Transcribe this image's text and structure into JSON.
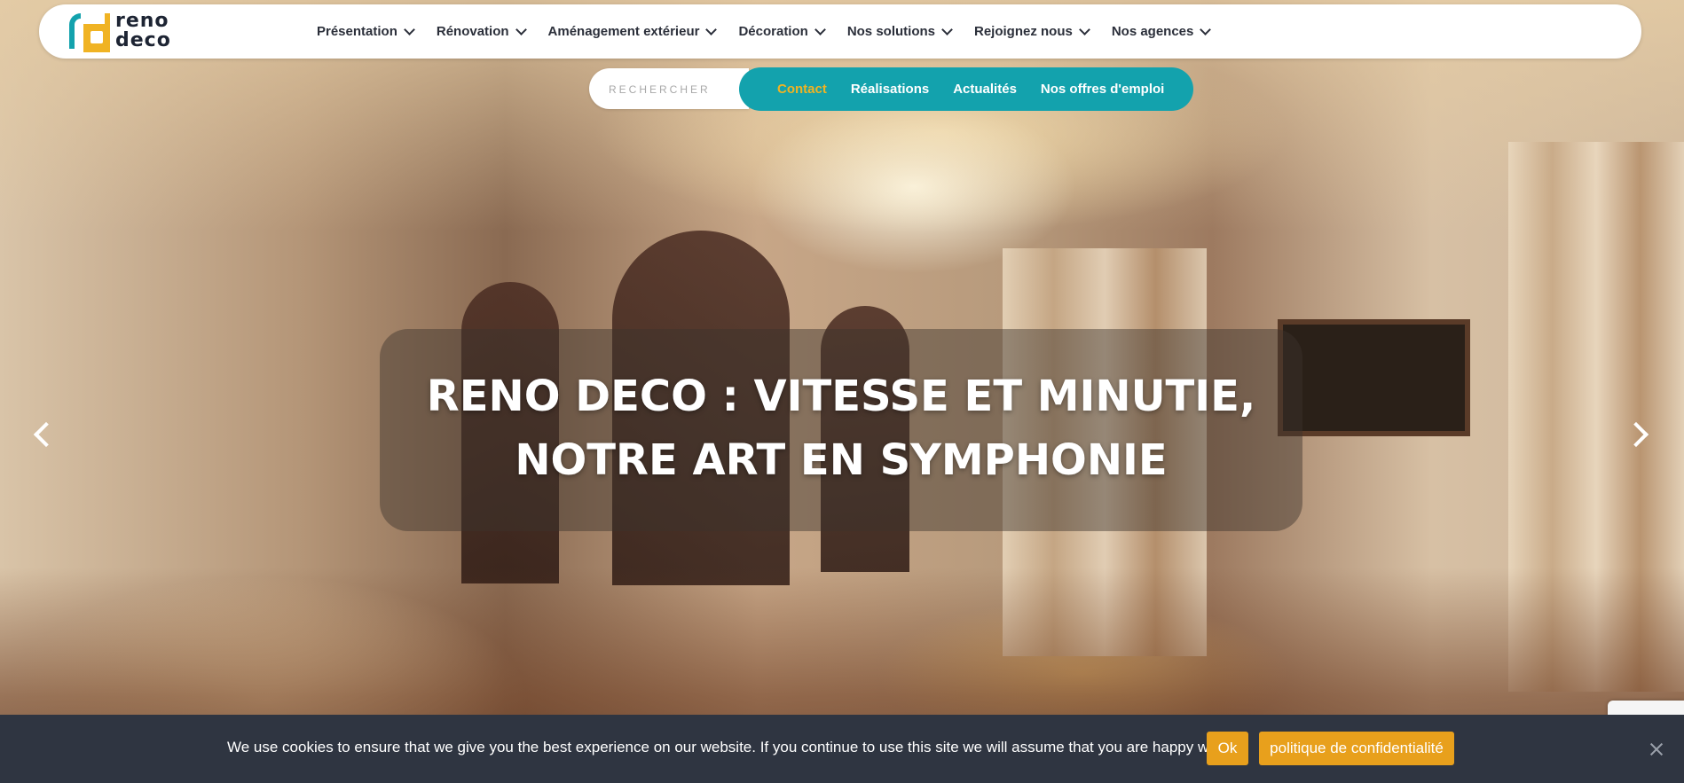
{
  "logo": {
    "line1": "reno",
    "line2": "deco"
  },
  "nav": {
    "items": [
      {
        "label": "Présentation"
      },
      {
        "label": "Rénovation"
      },
      {
        "label": "Aménagement extérieur"
      },
      {
        "label": "Décoration"
      },
      {
        "label": "Nos solutions"
      },
      {
        "label": "Rejoignez nous"
      },
      {
        "label": "Nos agences"
      }
    ]
  },
  "search": {
    "placeholder": "RECHERCHER"
  },
  "subnav": {
    "items": [
      {
        "label": "Contact"
      },
      {
        "label": "Réalisations"
      },
      {
        "label": "Actualités"
      },
      {
        "label": "Nos offres d'emploi"
      }
    ],
    "active_color": "#f0b323"
  },
  "hero": {
    "headline_line1": "RENO DECO : VITESSE ET MINUTIE,",
    "headline_line2": "NOTRE ART EN SYMPHONIE"
  },
  "cookie": {
    "text": "We use cookies to ensure that we give you the best experience on our website. If you continue to use this site we will assume that you are happy with it.",
    "ok_label": "Ok",
    "privacy_label": "politique de confidentialité"
  },
  "colors": {
    "teal": "#13a2ad",
    "yellow": "#f0b323",
    "dark": "#2f3541",
    "cookie_button": "#e8a01c"
  }
}
